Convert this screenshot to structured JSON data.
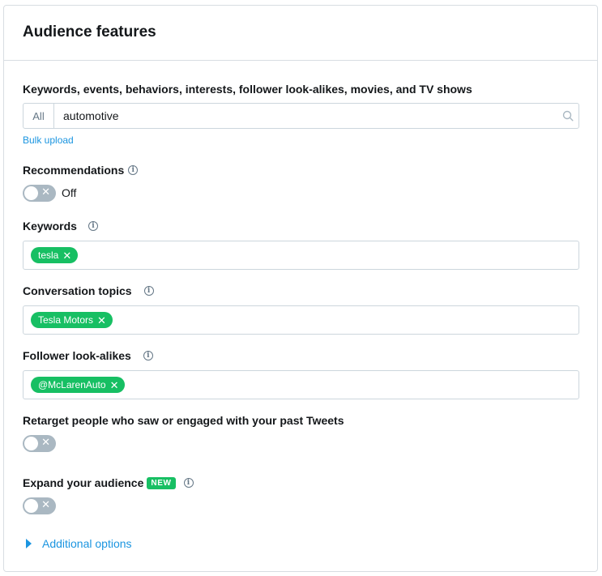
{
  "panel": {
    "title": "Audience features"
  },
  "search": {
    "label": "Keywords, events, behaviors, interests, follower look-alikes, movies, and TV shows",
    "scope": "All",
    "value": "automotive",
    "placeholder": "",
    "icon": "search-icon",
    "bulk_upload": "Bulk upload"
  },
  "recommendations": {
    "label": "Recommendations",
    "enabled": false,
    "state_text": "Off"
  },
  "keywords": {
    "label": "Keywords",
    "tokens": [
      "tesla"
    ]
  },
  "conversation_topics": {
    "label": "Conversation topics",
    "tokens": [
      "Tesla Motors"
    ]
  },
  "follower_lookalikes": {
    "label": "Follower look-alikes",
    "tokens": [
      "@McLarenAuto"
    ]
  },
  "retarget": {
    "label": "Retarget people who saw or engaged with your past Tweets",
    "enabled": false
  },
  "expand_audience": {
    "label": "Expand your audience",
    "badge": "NEW",
    "enabled": false
  },
  "additional_options": {
    "label": "Additional options",
    "expanded": false
  },
  "colors": {
    "accent": "#1b95e0",
    "token_green": "#17bf63",
    "toggle_off": "#aab8c2",
    "border": "#ccd6dd"
  }
}
